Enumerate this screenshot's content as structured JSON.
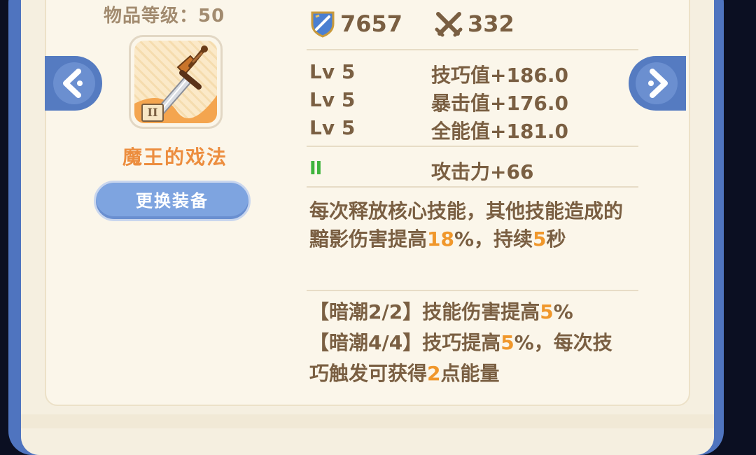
{
  "item": {
    "level_label": "物品等级：50",
    "name": "魔王的戏法",
    "tier": "II",
    "change_button": "更换装备"
  },
  "top_stats": {
    "power": "7657",
    "attack": "332"
  },
  "substats": [
    {
      "level": "Lv 5",
      "text": "技巧值+186.0"
    },
    {
      "level": "Lv 5",
      "text": "暴击值+176.0"
    },
    {
      "level": "Lv 5",
      "text": "全能值+181.0"
    }
  ],
  "rune": {
    "mark": "II",
    "text": "攻击力+66"
  },
  "effect": {
    "part1": "每次释放核心技能，其他技能造成的黯影伤害提高",
    "value1": "18",
    "part2": "%，持续",
    "value2": "5",
    "part3": "秒"
  },
  "set_bonus": {
    "line1_prefix": "【暗潮2/2】技能伤害提高",
    "line1_value": "5",
    "line1_suffix": "%",
    "line2_prefix": "【暗潮4/4】技巧提高",
    "line2_value": "5",
    "line2_mid": "%，每次技巧触发可获得",
    "line2_value2": "2",
    "line2_suffix": "点能量"
  },
  "colors": {
    "frame_blue": "#4f74bf",
    "panel": "#fbf6ea",
    "text_brown": "#7a5f42",
    "highlight_orange": "#f0972b",
    "name_orange": "#ec8d3e",
    "rune_green": "#3fb43d",
    "button_blue": "#7ea4e0"
  },
  "icons": [
    "shield-icon",
    "crossed-swords-icon",
    "dagger-icon",
    "chevron-left-icon",
    "chevron-right-icon"
  ]
}
